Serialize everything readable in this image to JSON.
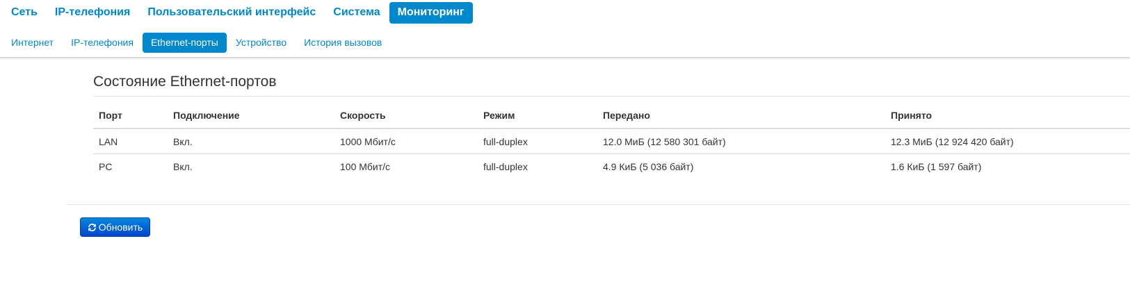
{
  "top_nav": [
    {
      "label": "Сеть",
      "active": false
    },
    {
      "label": "IP-телефония",
      "active": false
    },
    {
      "label": "Пользовательский интерфейс",
      "active": false
    },
    {
      "label": "Система",
      "active": false
    },
    {
      "label": "Мониторинг",
      "active": true
    }
  ],
  "sub_nav": [
    {
      "label": "Интернет",
      "active": false
    },
    {
      "label": "IP-телефония",
      "active": false
    },
    {
      "label": "Ethernet-порты",
      "active": true
    },
    {
      "label": "Устройство",
      "active": false
    },
    {
      "label": "История вызовов",
      "active": false
    }
  ],
  "section": {
    "title": "Состояние Ethernet-портов"
  },
  "table": {
    "headers": [
      "Порт",
      "Подключение",
      "Скорость",
      "Режим",
      "Передано",
      "Принято"
    ],
    "rows": [
      [
        "LAN",
        "Вкл.",
        "1000 Мбит/с",
        "full-duplex",
        "12.0 МиБ (12 580 301 байт)",
        "12.3 МиБ (12 924 420 байт)"
      ],
      [
        "PC",
        "Вкл.",
        "100 Мбит/с",
        "full-duplex",
        "4.9 КиБ (5 036 байт)",
        "1.6 КиБ (1 597 байт)"
      ]
    ]
  },
  "refresh_button": {
    "label": "Обновить",
    "icon": "refresh-icon"
  },
  "colors": {
    "accent": "#0088cc",
    "button_top": "#0088dd",
    "button_bottom": "#0044cc",
    "text": "#333333",
    "rule": "#dddddd"
  }
}
